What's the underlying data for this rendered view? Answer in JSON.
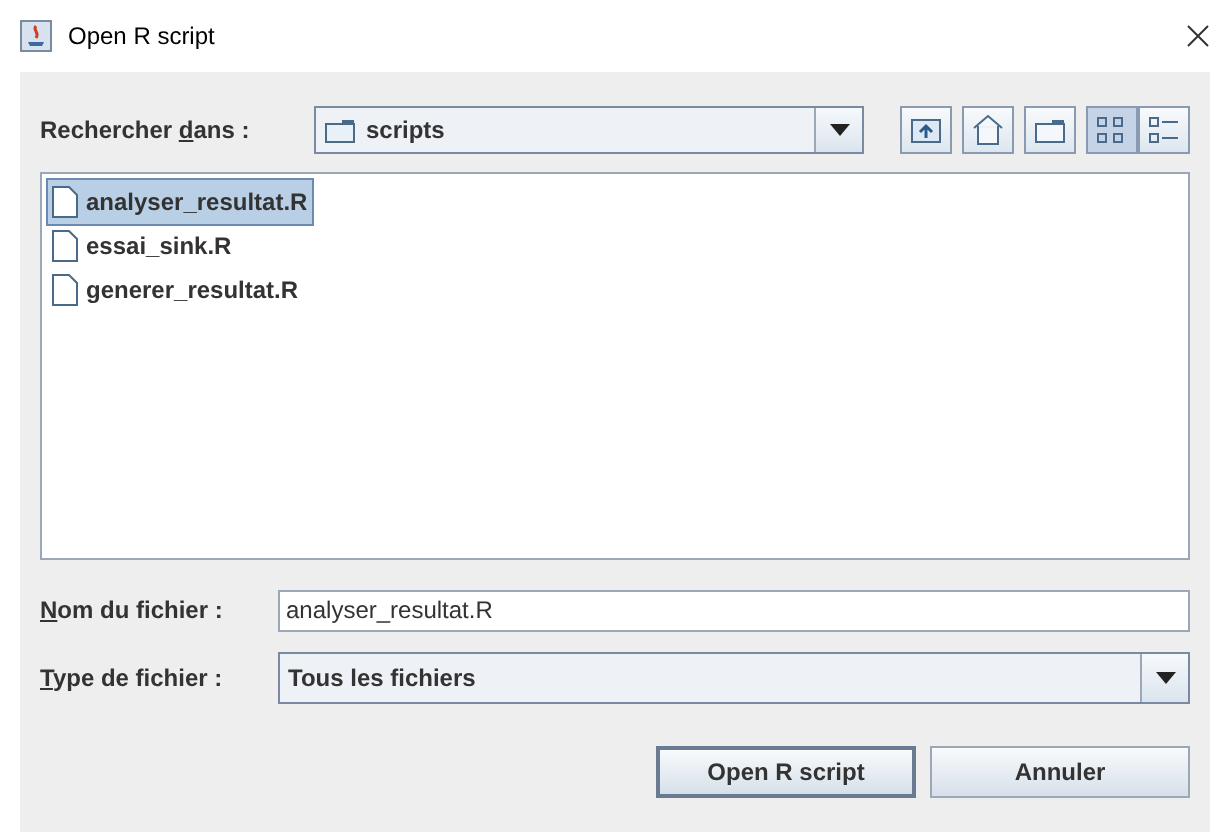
{
  "window": {
    "title": "Open R script"
  },
  "look_in": {
    "label": {
      "before": "Rechercher ",
      "key": "d",
      "after": "ans :"
    },
    "value": "scripts"
  },
  "toolbar": [
    {
      "kind": "up"
    },
    {
      "kind": "home"
    },
    {
      "kind": "new-folder"
    },
    {
      "kind": "list-view",
      "selected": true
    },
    {
      "kind": "details-view",
      "selected": false
    }
  ],
  "files": [
    {
      "name": "analyser_resultat.R",
      "selected": true
    },
    {
      "name": "essai_sink.R",
      "selected": false
    },
    {
      "name": "generer_resultat.R",
      "selected": false
    }
  ],
  "file_name": {
    "label": {
      "key": "N",
      "after": "om du fichier :"
    },
    "value": "analyser_resultat.R"
  },
  "file_type": {
    "label": {
      "key": "T",
      "after": "ype de fichier :"
    },
    "value": "Tous les fichiers"
  },
  "buttons": [
    {
      "label": "Open R script"
    },
    {
      "label": "Annuler"
    }
  ]
}
